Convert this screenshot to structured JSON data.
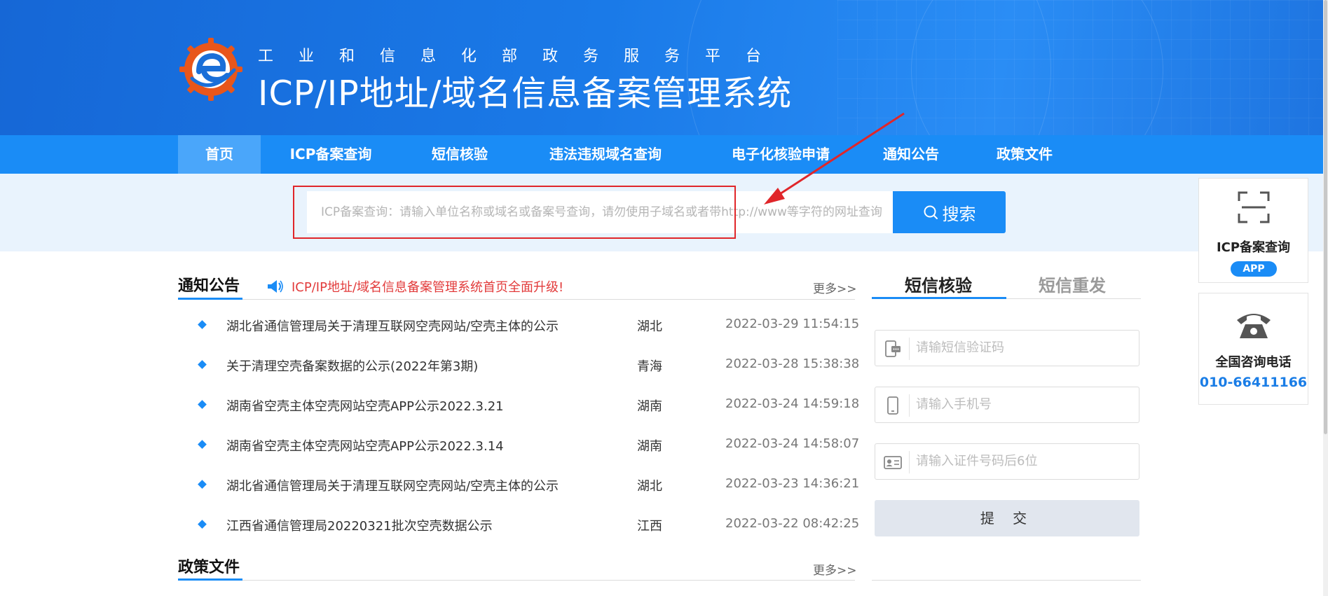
{
  "header": {
    "subtitle": "工业和信息化部政务服务平台",
    "title": "ICP/IP地址/域名信息备案管理系统"
  },
  "nav": {
    "items": [
      {
        "label": "首页",
        "active": true
      },
      {
        "label": "ICP备案查询"
      },
      {
        "label": "短信核验"
      },
      {
        "label": "违法违规域名查询"
      },
      {
        "label": "电子化核验申请"
      },
      {
        "label": "通知公告"
      },
      {
        "label": "政策文件"
      }
    ]
  },
  "search": {
    "placeholder": "ICP备案查询：请输入单位名称或域名或备案号查询，请勿使用子域名或者带http://www等字符的网址查询",
    "button_label": "搜索"
  },
  "notices": {
    "title": "通知公告",
    "ticker": "ICP/IP地址/域名信息备案管理系统首页全面升级!",
    "more": "更多>>",
    "items": [
      {
        "title": "湖北省通信管理局关于清理互联网空壳网站/空壳主体的公示",
        "region": "湖北",
        "time": "2022-03-29 11:54:15"
      },
      {
        "title": "关于清理空壳备案数据的公示(2022年第3期)",
        "region": "青海",
        "time": "2022-03-28 15:38:38"
      },
      {
        "title": "湖南省空壳主体空壳网站空壳APP公示2022.3.21",
        "region": "湖南",
        "time": "2022-03-24 14:59:18"
      },
      {
        "title": "湖南省空壳主体空壳网站空壳APP公示2022.3.14",
        "region": "湖南",
        "time": "2022-03-24 14:58:07"
      },
      {
        "title": "湖北省通信管理局关于清理互联网空壳网站/空壳主体的公示",
        "region": "湖北",
        "time": "2022-03-23 14:36:21"
      },
      {
        "title": "江西省通信管理局20220321批次空壳数据公示",
        "region": "江西",
        "time": "2022-03-22 08:42:25"
      }
    ]
  },
  "policy": {
    "title": "政策文件",
    "more": "更多>>"
  },
  "sms": {
    "tabs": [
      "短信核验",
      "短信重发"
    ],
    "code_placeholder": "请输短信验证码",
    "phone_placeholder": "请输入手机号",
    "id_placeholder": "请输入证件号码后6位",
    "submit_label": "提 交"
  },
  "side": {
    "app_title": "ICP备案查询",
    "app_badge": "APP",
    "hotline_title": "全国咨询电话",
    "hotline_number": "010-66411166"
  },
  "colors": {
    "primary": "#1a8cf6",
    "banner": "#1a7ae8",
    "alert": "#e23b3b"
  }
}
